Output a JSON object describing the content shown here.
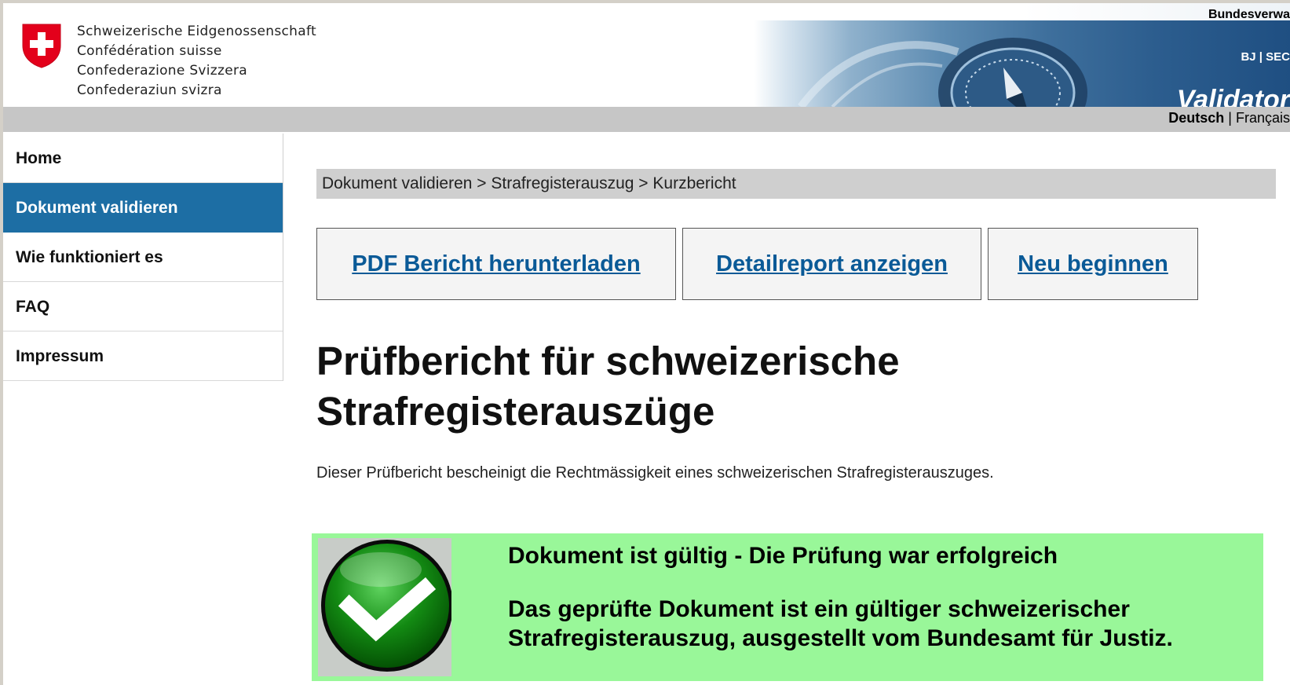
{
  "header": {
    "confederation_names": [
      "Schweizerische Eidgenossenschaft",
      "Confédération suisse",
      "Confederazione Svizzera",
      "Confederaziun svizra"
    ],
    "admin_label": "Bundesverwa",
    "org_label": "BJ | SEC",
    "app_title": "Validator",
    "languages": {
      "de": "Deutsch",
      "separator": " | ",
      "fr": "Français"
    }
  },
  "sidebar": {
    "items": [
      {
        "label": "Home",
        "active": false
      },
      {
        "label": "Dokument validieren",
        "active": true
      },
      {
        "label": "Wie funktioniert es",
        "active": false
      },
      {
        "label": "FAQ",
        "active": false
      },
      {
        "label": "Impressum",
        "active": false
      }
    ]
  },
  "main": {
    "breadcrumb": "Dokument validieren > Strafregisterauszug > Kurzbericht",
    "buttons": {
      "pdf": "PDF Bericht herunterladen",
      "detail": "Detailreport anzeigen",
      "restart": "Neu beginnen"
    },
    "title_line1": "Prüfbericht für schweizerische",
    "title_line2": "Strafregisterauszüge",
    "intro": "Dieser Prüfbericht bescheinigt die Rechtmässigkeit eines schweizerischen Strafregisterauszuges.",
    "result": {
      "title": "Dokument ist gültig - Die Prüfung war erfolgreich",
      "message_line1": "Das geprüfte Dokument ist ein gültiger schweizerischer",
      "message_line2": "Strafregisterauszug, ausgestellt vom Bundesamt für Justiz.",
      "icon": "checkmark-icon"
    }
  },
  "colors": {
    "nav_active": "#1d6ea4",
    "link": "#0a5a97",
    "success_bg": "#99f799",
    "swiss_red": "#e3001b"
  }
}
